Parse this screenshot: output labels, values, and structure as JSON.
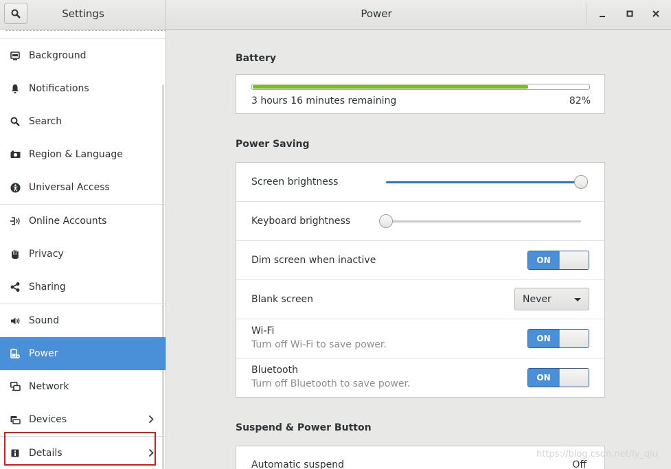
{
  "header": {
    "sidebar_title": "Settings",
    "title": "Power",
    "minimize_icon": "minimize-icon",
    "maximize_icon": "maximize-icon",
    "close_icon": "close-icon"
  },
  "sidebar": {
    "items": [
      {
        "label": "Background",
        "icon": "background-icon"
      },
      {
        "label": "Notifications",
        "icon": "bell-icon"
      },
      {
        "label": "Search",
        "icon": "search-icon"
      },
      {
        "label": "Region & Language",
        "icon": "camera-icon"
      },
      {
        "label": "Universal Access",
        "icon": "accessibility-icon"
      },
      {
        "label": "Online Accounts",
        "icon": "online-accounts-icon"
      },
      {
        "label": "Privacy",
        "icon": "hand-icon"
      },
      {
        "label": "Sharing",
        "icon": "share-icon"
      },
      {
        "label": "Sound",
        "icon": "speaker-icon"
      },
      {
        "label": "Power",
        "icon": "power-icon",
        "active": true
      },
      {
        "label": "Network",
        "icon": "network-icon"
      },
      {
        "label": "Devices",
        "icon": "devices-icon"
      },
      {
        "label": "Details",
        "icon": "info-icon"
      }
    ]
  },
  "battery": {
    "title": "Battery",
    "remaining": "3 hours 16 minutes remaining",
    "percent_label": "82%",
    "level": 0.82,
    "color": "#73c117"
  },
  "power_saving": {
    "title": "Power Saving",
    "screen_brightness": {
      "label": "Screen brightness",
      "level": 1.0
    },
    "keyboard_brightness": {
      "label": "Keyboard brightness",
      "level": 0.0
    },
    "dim_screen": {
      "label": "Dim screen when inactive",
      "state": "ON"
    },
    "blank_screen": {
      "label": "Blank screen",
      "value": "Never"
    },
    "wifi": {
      "label": "Wi-Fi",
      "sub": "Turn off Wi-Fi to save power.",
      "state": "ON"
    },
    "bluetooth": {
      "label": "Bluetooth",
      "sub": "Turn off Bluetooth to save power.",
      "state": "ON"
    }
  },
  "suspend": {
    "title": "Suspend & Power Button",
    "automatic_suspend": {
      "label": "Automatic suspend",
      "value": "Off"
    }
  },
  "watermark": "https://blog.csdn.net/ly_qiu",
  "colors": {
    "accent": "#4a90d9",
    "highlight": "#e0161b"
  }
}
